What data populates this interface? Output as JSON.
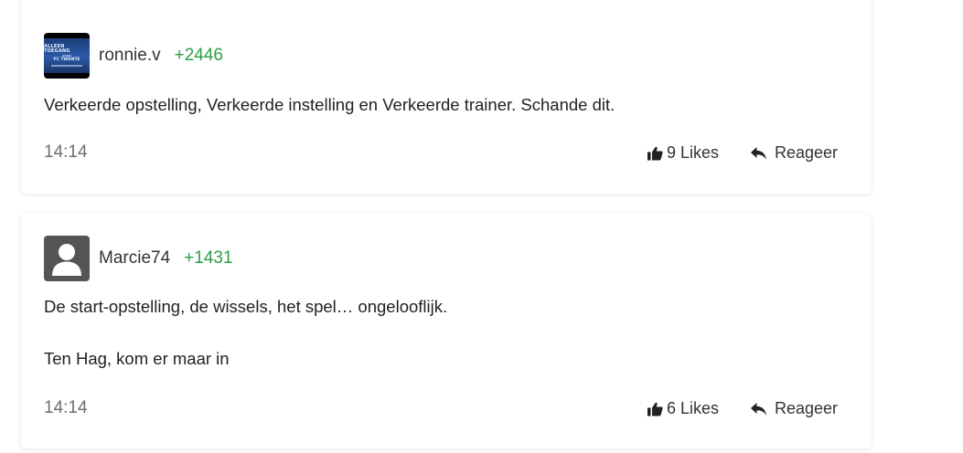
{
  "comments": [
    {
      "username": "ronnie.v",
      "score": "+2446",
      "avatar_icon": "team-banner-avatar",
      "avatar_text": [
        "ALLEEN TOEGANG",
        "VOOR",
        "FC TWENTE",
        ""
      ],
      "paragraphs": [
        "Verkeerde opstelling, Verkeerde instelling en Verkeerde trainer. Schande dit."
      ],
      "time": "14:14",
      "likes_label": "9 Likes",
      "reply_label": "Reageer"
    },
    {
      "username": "Marcie74",
      "score": "+1431",
      "avatar_icon": "default-user-avatar",
      "paragraphs": [
        "De start-opstelling, de wissels, het spel… ongelooflijk.",
        "Ten Hag, kom er maar in"
      ],
      "time": "14:14",
      "likes_label": "6 Likes",
      "reply_label": "Reageer"
    }
  ],
  "colors": {
    "score": "#2e9e44",
    "text": "#222222",
    "muted": "#6f6f6f",
    "avatar_bg": "#555555"
  }
}
